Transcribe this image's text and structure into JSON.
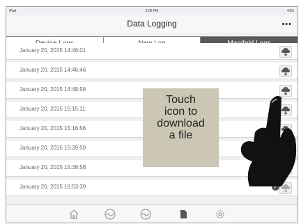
{
  "status_bar": {
    "left": "iPad",
    "time": "2:02 PM",
    "right": "41%"
  },
  "nav": {
    "title": "Data Logging",
    "more": "•••"
  },
  "tabs": [
    {
      "label": "Device Logs",
      "active": false
    },
    {
      "label": "New Log",
      "active": false
    },
    {
      "label": "Manifold Logs",
      "active": true
    }
  ],
  "logs": [
    {
      "date": "January 20, 2015 14:46:01"
    },
    {
      "date": "January 20, 2015 14:46:46"
    },
    {
      "date": "January 20, 2015 14:48:58"
    },
    {
      "date": "January 20, 2015 15:15:11"
    },
    {
      "date": "January 20, 2015 15:16:56"
    },
    {
      "date": "January 20, 2015 15:39:50"
    },
    {
      "date": "January 20, 2015 15:39:58"
    },
    {
      "date": "January 20, 2015 16:53:39"
    }
  ],
  "tooltip": {
    "text": "Touch\nicon to\ndownload\na file"
  },
  "toolbar_icons": [
    "home-icon",
    "gauge-icon",
    "logging-icon",
    "document-icon",
    "settings-icon"
  ],
  "colors": {
    "active_tab": "#5a5a5a",
    "tooltip_bg": "#ccc6b4",
    "hand": "#111111"
  }
}
